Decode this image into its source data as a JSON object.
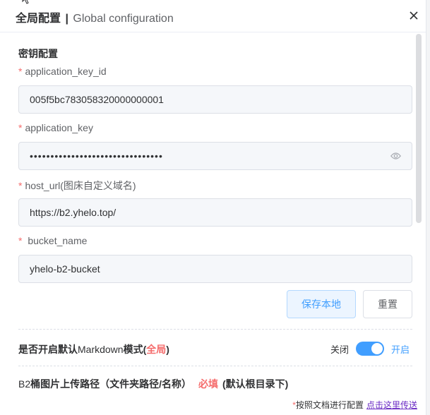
{
  "dialog": {
    "title_cn": "全局配置",
    "title_sep": "|",
    "title_en": "Global configuration",
    "close_icon": "close-icon"
  },
  "section": {
    "title": "密钥配置"
  },
  "fields": [
    {
      "label": "application_key_id",
      "value": "005f5bc783058320000000001",
      "required": true
    },
    {
      "label": "application_key",
      "value": "••••••••••••••••••••••••••••••••",
      "required": true,
      "type": "password"
    },
    {
      "label": "host_url(图床自定义域名)",
      "value": "https://b2.yhelo.top/",
      "required": true
    },
    {
      "label": " bucket_name",
      "value": "yhelo-b2-bucket",
      "required": true
    }
  ],
  "required_mark": "*",
  "buttons": {
    "save": "保存本地",
    "reset": "重置"
  },
  "markdown": {
    "label_prefix": "是否开启默认",
    "label_md": "Markdown",
    "label_mode": "模式(",
    "label_global": "全局",
    "label_close": ")",
    "switch_off": "关闭",
    "switch_on": "开启",
    "enabled": true
  },
  "b2_path": {
    "prefix": "B2",
    "label": "桶图片上传路径（文件夹路径/名称）",
    "must": "必填",
    "hint": "(默认根目录下)"
  },
  "footer": {
    "star": "*",
    "text": "按照文档进行配置",
    "link": "点击这里传送"
  },
  "colors": {
    "primary": "#409eff",
    "danger": "#f56c6c",
    "link": "#6a2bc4"
  }
}
